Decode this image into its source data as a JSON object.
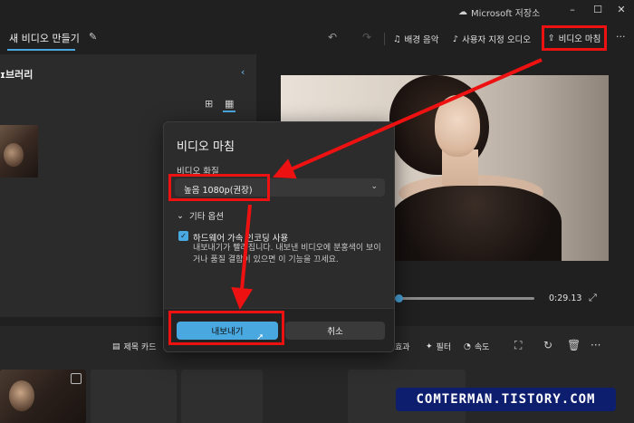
{
  "titlebar": {
    "storage_label": "Microsoft 저장소",
    "minimize": "–",
    "maximize": "☐",
    "close": "✕"
  },
  "toolbar": {
    "project_title": "새 비디오 만들기",
    "background_music": "배경 음악",
    "custom_audio": "사용자 지정 오디오",
    "finish_video": "비디오 마침",
    "more": "···"
  },
  "library": {
    "title": "ɪ브러리"
  },
  "player": {
    "time": "0:29.13"
  },
  "storyboard": {
    "title_card": "제목 카드",
    "effects": "효과",
    "filter": "필터",
    "speed": "속도"
  },
  "dialog": {
    "title": "비디오 마침",
    "quality_label": "비디오 화질",
    "quality_value": "높음 1080p(권장)",
    "more_options": "기타 옵션",
    "hw_accel_label": "하드웨어 가속 인코딩 사용",
    "hw_accel_desc": "내보내기가 빨라집니다. 내보낸 비디오에 분홍색이 보이거나 품질 결함이 있으면 이 기능을 끄세요.",
    "hw_accel_checked": true,
    "export_button": "내보내기",
    "cancel_button": "취소"
  },
  "watermark": "COMTERMAN.TISTORY.COM",
  "colors": {
    "accent": "#4aa8e0",
    "annotation": "#ee1111",
    "watermark_bg": "#0d1e6e"
  }
}
